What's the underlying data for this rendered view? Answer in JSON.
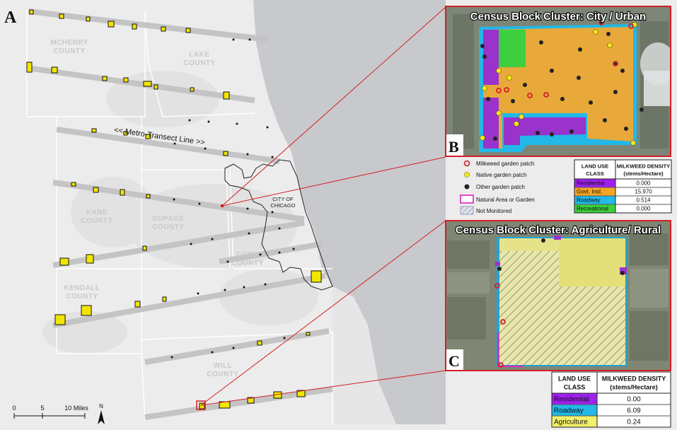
{
  "panels": {
    "a": "A",
    "b": "B",
    "c": "C"
  },
  "counties": {
    "mchenry": [
      "MCHENRY",
      "COUNTY"
    ],
    "lake": [
      "LAKE",
      "COUNTY"
    ],
    "kane": [
      "KANE",
      "COUNTY"
    ],
    "dupage": [
      "DUPAGE",
      "COUNTY"
    ],
    "cook": [
      "COOK",
      "COUNTY"
    ],
    "kendall": [
      "KENDALL",
      "COUNTY"
    ],
    "will": [
      "WILL",
      "COUNTY"
    ]
  },
  "city_label": [
    "CITY OF",
    "CHICAGO"
  ],
  "transect_label": "<< Metro-Transect Line >>",
  "scale_bar": {
    "t0": "0",
    "t1": "5",
    "t2": "10 Miles"
  },
  "north_arrow": "N",
  "inset_urban": {
    "title": "Census Block Cluster: City / Urban"
  },
  "inset_rural": {
    "title": "Census Block Cluster: Agriculture/ Rural"
  },
  "legend": {
    "items": [
      {
        "label": "Milkweed garden patch",
        "icon": "red-ring-icon"
      },
      {
        "label": "Native garden patch",
        "icon": "yellow-dot-icon"
      },
      {
        "label": "Other garden patch",
        "icon": "black-dot-icon"
      },
      {
        "label": "Natural Area or Garden",
        "icon": "magenta-box-icon"
      },
      {
        "label": "Not Monitored",
        "icon": "hatched-box-icon"
      }
    ]
  },
  "table_urban": {
    "header": [
      "LAND USE",
      "CLASS",
      "MILKWEED DENSITY",
      "(stems/Hectare)"
    ],
    "rows": [
      {
        "class": "Residential",
        "value": "0.000",
        "color": "#a020f0"
      },
      {
        "class": "Govt. Inst.",
        "value": "15.970",
        "color": "#f5a623"
      },
      {
        "class": "Roadway",
        "value": "0.514",
        "color": "#22b8e8"
      },
      {
        "class": "Recreational",
        "value": "0.000",
        "color": "#3ecf3e"
      }
    ]
  },
  "table_rural": {
    "header": [
      "LAND USE",
      "CLASS",
      "MILKWEED DENSITY",
      "(stems/Hectare)"
    ],
    "rows": [
      {
        "class": "Residential",
        "value": "0.00",
        "color": "#a020f0"
      },
      {
        "class": "Roadway",
        "value": "6.09",
        "color": "#22b8e8"
      },
      {
        "class": "Agriculture",
        "value": "0.24",
        "color": "#f3f06a"
      }
    ]
  },
  "colors": {
    "lake": "#c8c9cc",
    "land": "#eeeeee",
    "transect": "#c4c4c4",
    "cluster": "#f2e600",
    "inset_border": "#d21f26"
  }
}
